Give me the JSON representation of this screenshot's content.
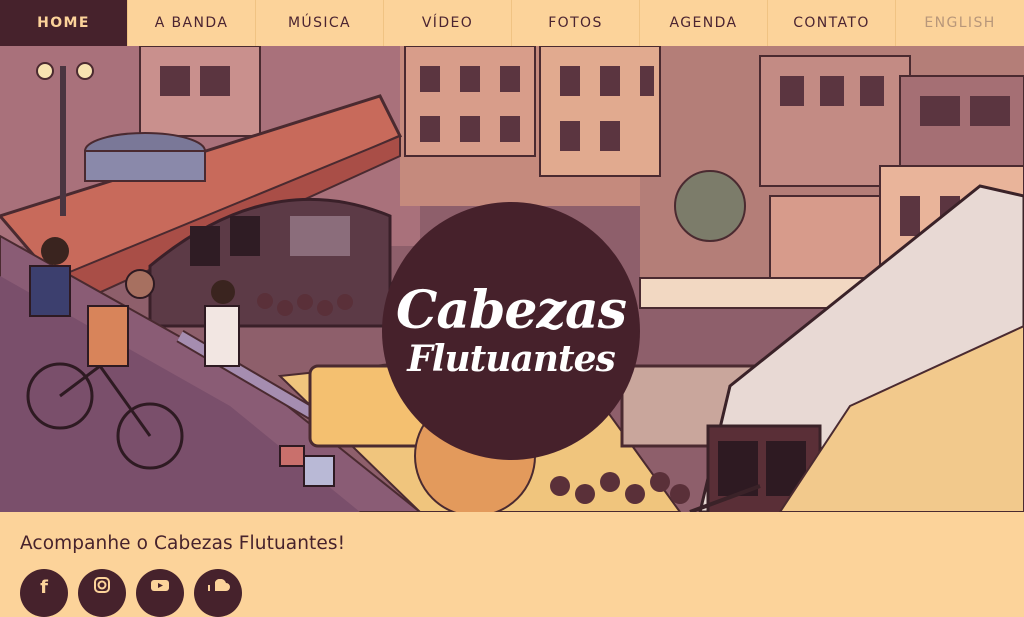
{
  "nav": {
    "items": [
      {
        "label": "HOME"
      },
      {
        "label": "A BANDA"
      },
      {
        "label": "MÚSICA"
      },
      {
        "label": "VÍDEO"
      },
      {
        "label": "FOTOS"
      },
      {
        "label": "AGENDA"
      },
      {
        "label": "CONTATO"
      },
      {
        "label": "ENGLISH"
      }
    ]
  },
  "hero": {
    "logo_line1": "Cabezas",
    "logo_line2": "Flutuantes"
  },
  "follow": {
    "text": "Acompanhe o Cabezas Flutuantes!"
  },
  "social": {
    "facebook_icon": "facebook-icon",
    "instagram_icon": "instagram-icon",
    "youtube_icon": "youtube-icon",
    "soundcloud_icon": "soundcloud-icon"
  },
  "colors": {
    "nav_bg": "#fcd39a",
    "nav_active_bg": "#46222c",
    "nav_text": "#4b2431",
    "logo_circle": "#46212b",
    "page_bg": "#fcd39a"
  }
}
